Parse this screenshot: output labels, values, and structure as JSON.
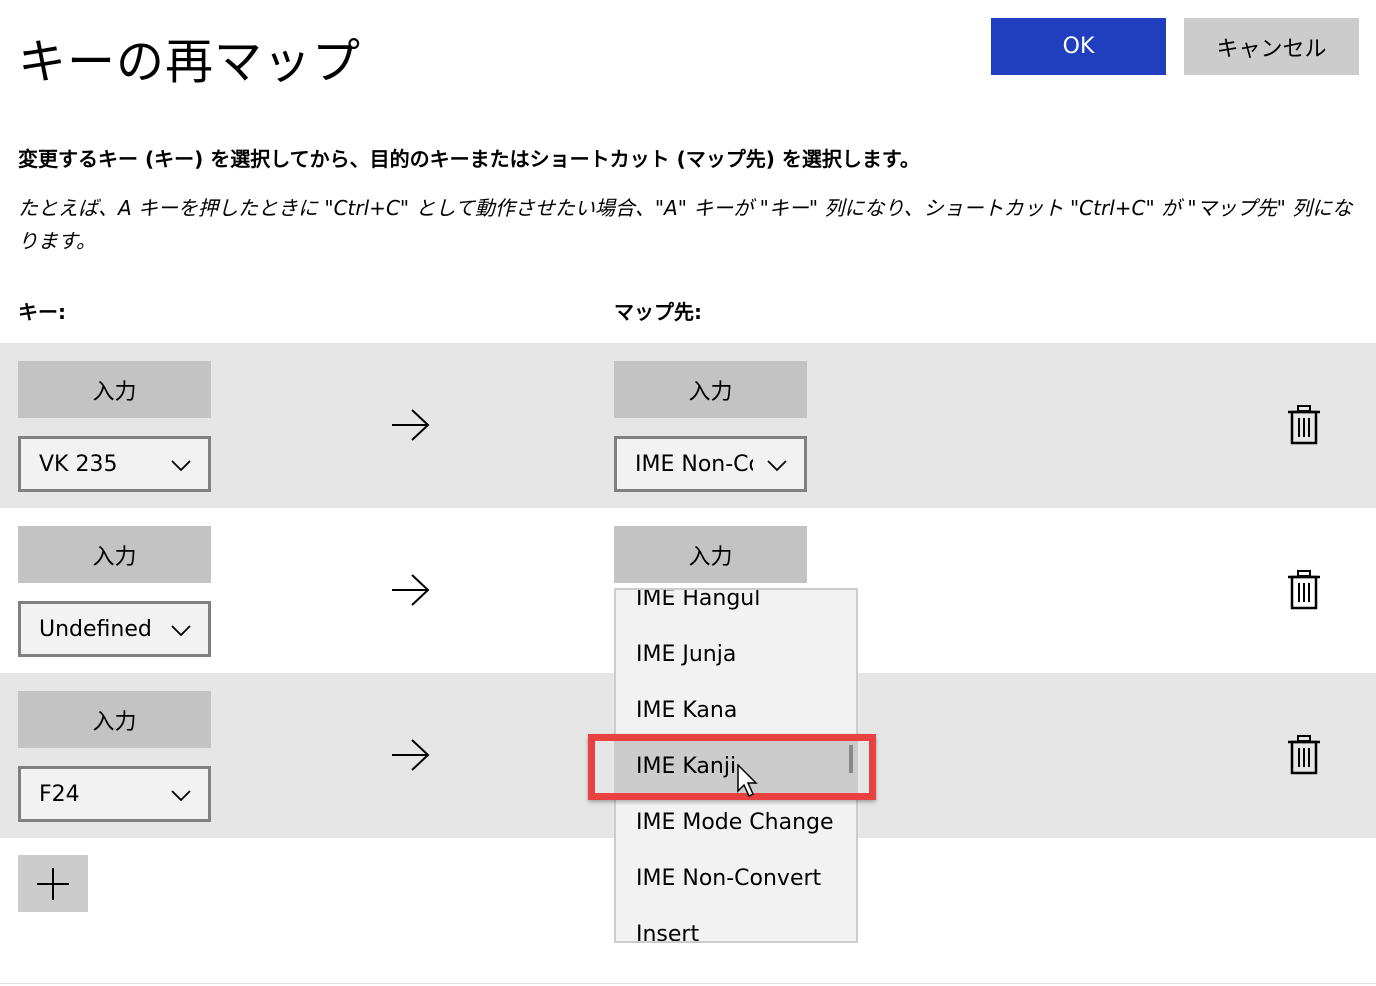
{
  "header": {
    "title": "キーの再マップ",
    "ok_label": "OK",
    "cancel_label": "キャンセル"
  },
  "instructions": {
    "description": "変更するキー (キー) を選択してから、目的のキーまたはショートカット (マップ先) を選択します。",
    "example": "たとえば、A キーを押したときに \"Ctrl+C\" として動作させたい場合、\"A\" キーが \"キー\" 列になり、ショートカット \"Ctrl+C\" が \"マップ先\" 列になります。"
  },
  "columns": {
    "key": "キー:",
    "mapped_to": "マップ先:"
  },
  "rows": [
    {
      "type_label": "入力",
      "key_value": "VK 235",
      "target_type_label": "入力",
      "target_value": "IME Non-Convert"
    },
    {
      "type_label": "入力",
      "key_value": "Undefined",
      "target_type_label": "入力",
      "target_value": ""
    },
    {
      "type_label": "入力",
      "key_value": "F24"
    }
  ],
  "dropdown": {
    "options": [
      "IME Hangul",
      "IME Junja",
      "IME Kana",
      "IME Kanji",
      "IME Mode Change",
      "IME Non-Convert",
      "Insert"
    ],
    "highlighted": "IME Kanji"
  },
  "icons": {
    "arrow": "arrow-right-icon",
    "delete": "trash-icon",
    "add": "plus-icon",
    "chevron": "chevron-down-icon"
  },
  "colors": {
    "ok_button": "#1f3fbf",
    "cancel_button": "#cccccc",
    "highlight_box": "#e8413f",
    "row_shade": "#e6e6e6"
  }
}
